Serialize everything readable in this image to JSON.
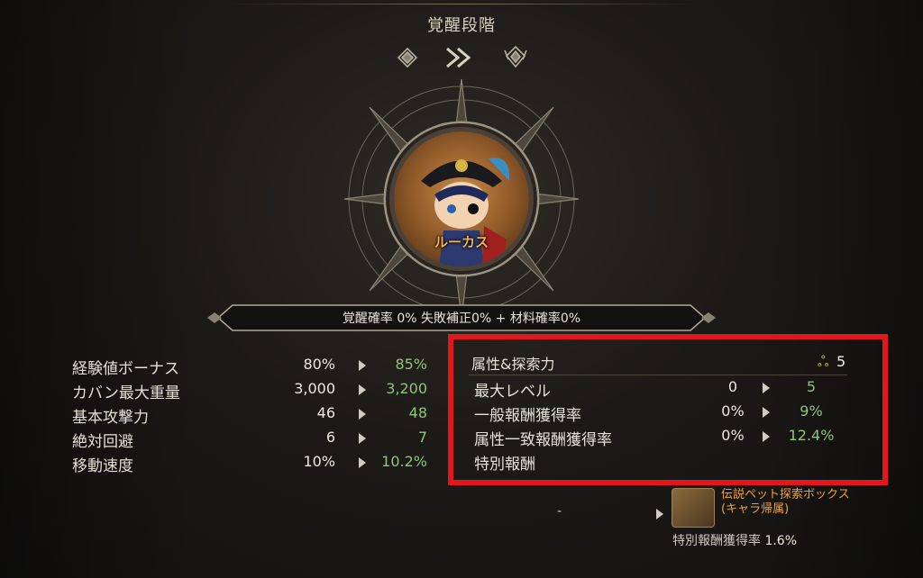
{
  "header": {
    "title": "覚醒段階"
  },
  "character": {
    "name": "ルーカス"
  },
  "banner": {
    "text": "覚醒確率 0%   失敗補正0% + 材料確率0%"
  },
  "stats": [
    {
      "label": "経験値ボーナス",
      "current": "80%",
      "next": "85%"
    },
    {
      "label": "カバン最大重量",
      "current": "3,000",
      "next": "3,200"
    },
    {
      "label": "基本攻撃力",
      "current": "46",
      "next": "48"
    },
    {
      "label": "絶対回避",
      "current": "6",
      "next": "7"
    },
    {
      "label": "移動速度",
      "current": "10%",
      "next": "10.2%"
    }
  ],
  "attribute": {
    "header": "属性&探索力",
    "count": "5",
    "rows": [
      {
        "label": "最大レベル",
        "current": "0",
        "next": "5"
      },
      {
        "label": "一般報酬獲得率",
        "current": "0%",
        "next": "9%"
      },
      {
        "label": "属性一致報酬獲得率",
        "current": "0%",
        "next": "12.4%"
      }
    ],
    "special_label": "特別報酬"
  },
  "reward": {
    "from": "-",
    "name_line1": "伝説ペット探索ボックス",
    "name_line2": "(キャラ帰属)",
    "rate_label": "特別報酬獲得率",
    "rate_value": "1.6%"
  },
  "colors": {
    "highlight_border": "#e0181b",
    "increase": "#8fc47a",
    "name": "#f5b24a",
    "reward_name": "#f0a23a"
  }
}
